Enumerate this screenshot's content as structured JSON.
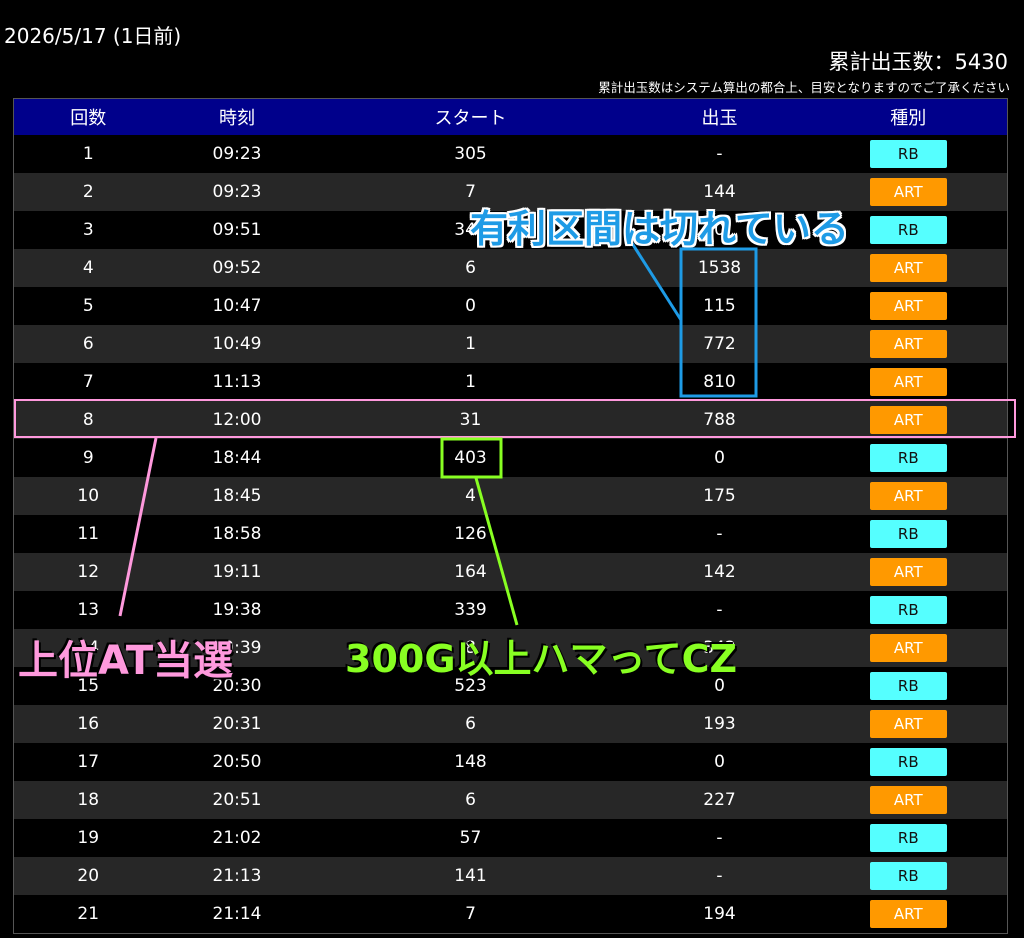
{
  "header": {
    "date": "2026/5/17 (1日前)",
    "total": "累計出玉数：5430",
    "note": "累計出玉数はシステム算出の都合上、目安となりますのでご了承ください"
  },
  "table": {
    "headers": [
      "回数",
      "時刻",
      "スタート",
      "出玉",
      "種別"
    ],
    "rows": [
      {
        "no": "1",
        "time": "09:23",
        "start": "305",
        "out": "-",
        "type": "RB"
      },
      {
        "no": "2",
        "time": "09:23",
        "start": "7",
        "out": "144",
        "type": "ART"
      },
      {
        "no": "3",
        "time": "09:51",
        "start": "349",
        "out": "0",
        "type": "RB"
      },
      {
        "no": "4",
        "time": "09:52",
        "start": "6",
        "out": "1538",
        "type": "ART"
      },
      {
        "no": "5",
        "time": "10:47",
        "start": "0",
        "out": "115",
        "type": "ART"
      },
      {
        "no": "6",
        "time": "10:49",
        "start": "1",
        "out": "772",
        "type": "ART"
      },
      {
        "no": "7",
        "time": "11:13",
        "start": "1",
        "out": "810",
        "type": "ART"
      },
      {
        "no": "8",
        "time": "12:00",
        "start": "31",
        "out": "788",
        "type": "ART"
      },
      {
        "no": "9",
        "time": "18:44",
        "start": "403",
        "out": "0",
        "type": "RB"
      },
      {
        "no": "10",
        "time": "18:45",
        "start": "4",
        "out": "175",
        "type": "ART"
      },
      {
        "no": "11",
        "time": "18:58",
        "start": "126",
        "out": "-",
        "type": "RB"
      },
      {
        "no": "12",
        "time": "19:11",
        "start": "164",
        "out": "142",
        "type": "ART"
      },
      {
        "no": "13",
        "time": "19:38",
        "start": "339",
        "out": "-",
        "type": "RB"
      },
      {
        "no": "14",
        "time": "19:39",
        "start": "8",
        "out": "342",
        "type": "ART"
      },
      {
        "no": "15",
        "time": "20:30",
        "start": "523",
        "out": "0",
        "type": "RB"
      },
      {
        "no": "16",
        "time": "20:31",
        "start": "6",
        "out": "193",
        "type": "ART"
      },
      {
        "no": "17",
        "time": "20:50",
        "start": "148",
        "out": "0",
        "type": "RB"
      },
      {
        "no": "18",
        "time": "20:51",
        "start": "6",
        "out": "227",
        "type": "ART"
      },
      {
        "no": "19",
        "time": "21:02",
        "start": "57",
        "out": "-",
        "type": "RB"
      },
      {
        "no": "20",
        "time": "21:13",
        "start": "141",
        "out": "-",
        "type": "RB"
      },
      {
        "no": "21",
        "time": "21:14",
        "start": "7",
        "out": "194",
        "type": "ART"
      }
    ]
  },
  "annotations": {
    "blue": "有利区間は切れている",
    "pink": "上位AT当選",
    "green": "300G以上ハマってCZ"
  },
  "colors": {
    "header_bg": "#00008b",
    "rb_badge": "#55ffff",
    "art_badge": "#ff9900",
    "annotation_blue": "#1e9be6",
    "annotation_pink": "#ff99dd",
    "annotation_green": "#88ff22"
  }
}
